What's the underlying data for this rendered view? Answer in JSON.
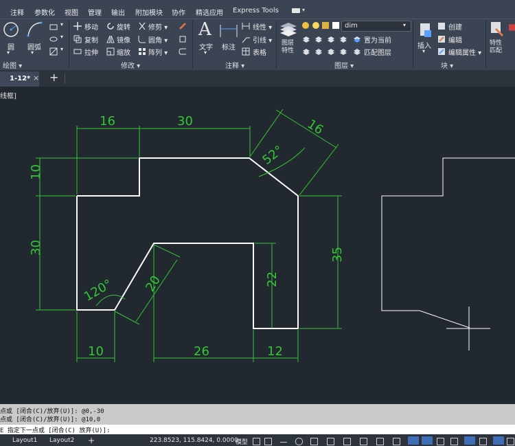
{
  "menu": [
    "注释",
    "参数化",
    "视图",
    "管理",
    "输出",
    "附加模块",
    "协作",
    "精选应用",
    "Express Tools"
  ],
  "ribbon": {
    "draw": {
      "title": "绘图 ▾",
      "circle": "圆",
      "arc": "圆弧"
    },
    "modify": {
      "title": "修改 ▾",
      "move": "移动",
      "rotate": "旋转",
      "trim": "修剪 ▾",
      "copy": "复制",
      "mirror": "镜像",
      "fillet": "圆角 ▾",
      "stretch": "拉伸",
      "scale": "缩放",
      "array": "阵列 ▾"
    },
    "annotation": {
      "title": "注释 ▾",
      "text": "文字",
      "dimension": "标注",
      "linear": "线性 ▾",
      "leader": "引线 ▾",
      "table": "表格"
    },
    "layers": {
      "title": "图层 ▾",
      "layer_props": "图层\n特性",
      "current_layer": "dim",
      "make_current": "置为当前",
      "match_layer": "匹配图层"
    },
    "block": {
      "title": "块 ▾",
      "insert": "插入",
      "create": "创建",
      "edit": "编辑",
      "edit_attr": "编辑属性 ▾"
    },
    "properties": {
      "match": "特性\n匹配"
    }
  },
  "tabs": {
    "active": "1-12*",
    "add": "+"
  },
  "viewport_label": "线框]",
  "drawing": {
    "dims": [
      "16",
      "30",
      "16",
      "52°",
      "10",
      "30",
      "120°",
      "20",
      "22",
      "35",
      "10",
      "26",
      "12"
    ]
  },
  "command_history": [
    "点或 [闭合(C)/放弃(U)]: @0,-30",
    "点或 [闭合(C)/放弃(U)]: @10,0"
  ],
  "command_prompt": "E 指定下一点或 [闭合(C) 放弃(U)]:",
  "status": {
    "layout1": "Layout1",
    "layout2": "Layout2",
    "add": "+",
    "coords": "223.8523, 115.8424, 0.0000",
    "model": "模型"
  }
}
